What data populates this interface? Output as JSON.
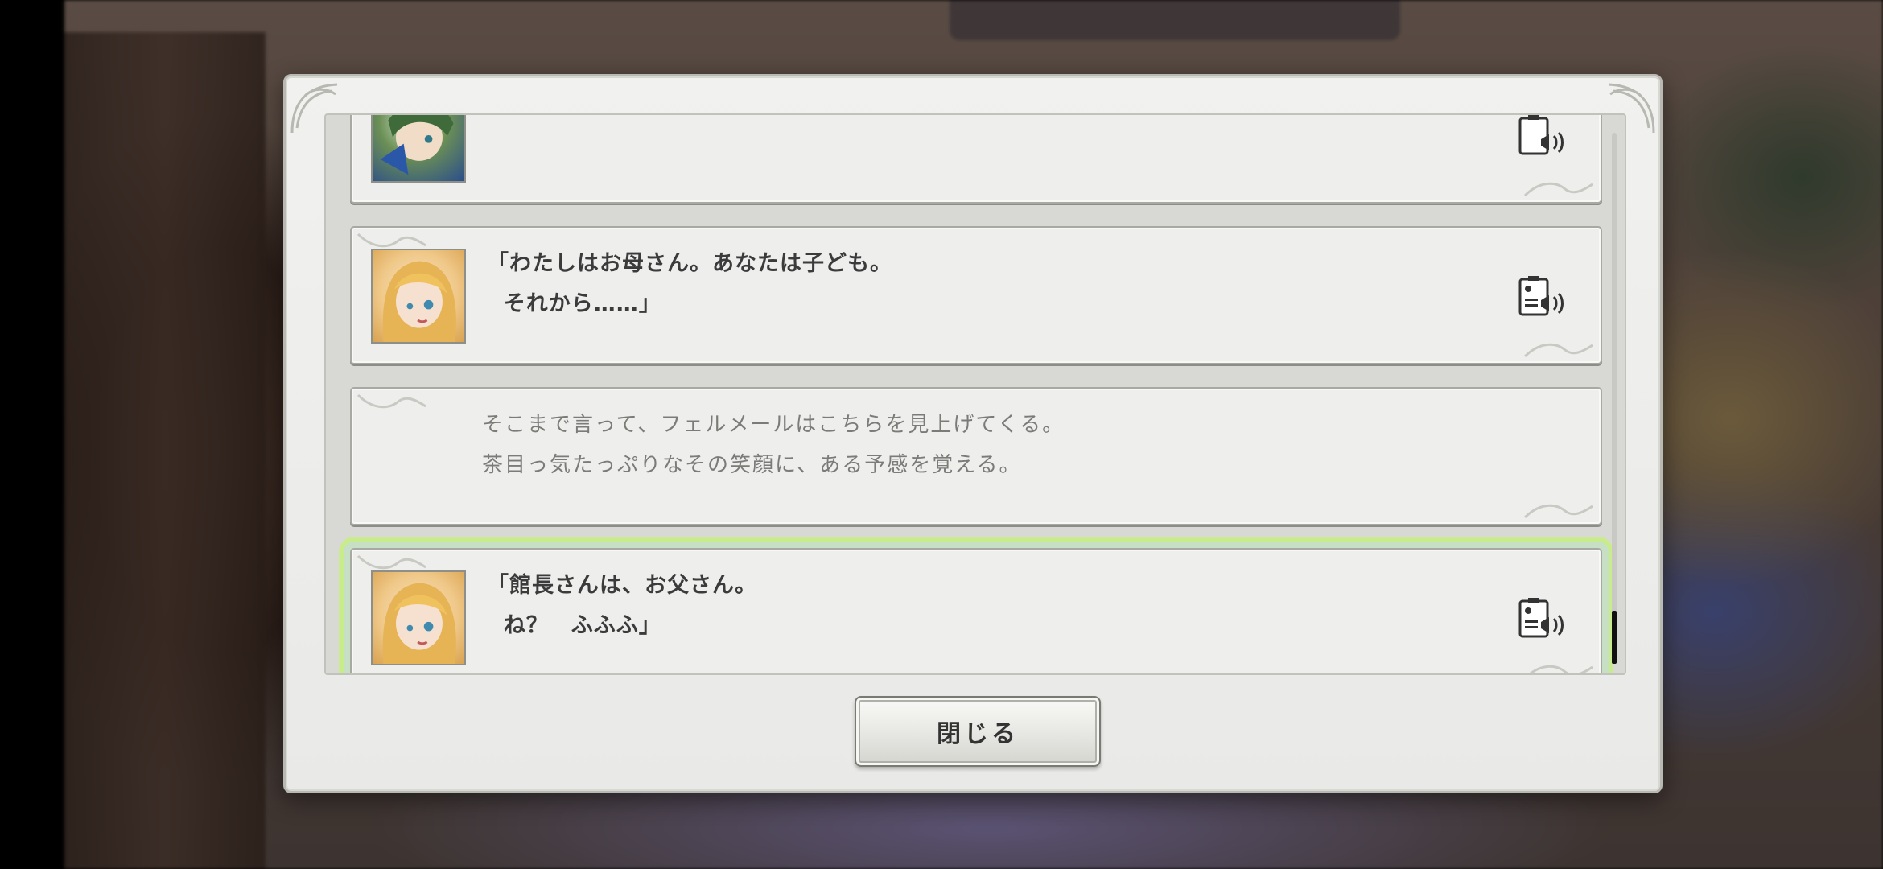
{
  "dialog": {
    "close_label": "閉じる"
  },
  "log": {
    "entries": [
      {
        "kind": "speech",
        "speaker_avatar": "green-haired-character-avatar",
        "lines": [
          ""
        ],
        "has_voice": true
      },
      {
        "kind": "speech",
        "speaker_avatar": "blonde-character-avatar",
        "lines": [
          "「わたしはお母さん。あなたは子ども。",
          "  それから……」"
        ],
        "has_voice": true
      },
      {
        "kind": "narration",
        "lines": [
          "そこまで言って、フェルメールはこちらを見上げてくる。",
          "茶目っ気たっぷりなその笑顔に、ある予感を覚える。"
        ],
        "has_voice": false
      },
      {
        "kind": "speech",
        "speaker_avatar": "blonde-character-avatar",
        "lines": [
          "「館長さんは、お父さん。",
          "  ね？　ふふふ」"
        ],
        "has_voice": true,
        "selected": true
      }
    ]
  },
  "icons": {
    "voice": "voice-replay-icon"
  },
  "colors": {
    "panel": "#eeeeed",
    "selection_glow": "#c8f078",
    "speech_text": "#3b3b3b",
    "narration_text": "#7b7b78"
  }
}
